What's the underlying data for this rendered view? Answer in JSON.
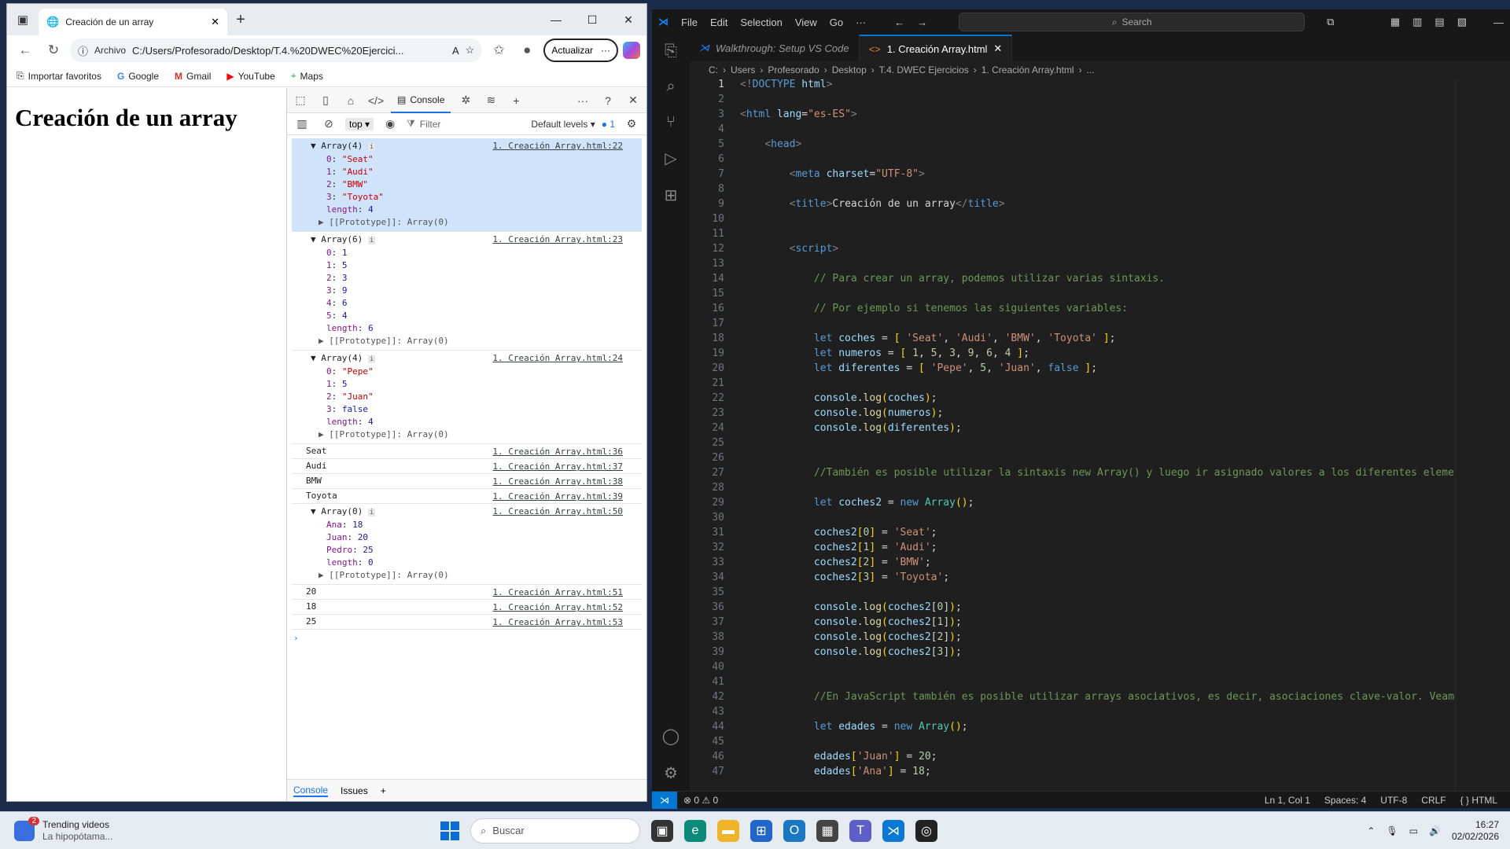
{
  "browser": {
    "tab_title": "Creación de un array",
    "address_chip": "Archivo",
    "url": "C:/Users/Profesorado/Desktop/T.4.%20DWEC%20Ejercici...",
    "update_label": "Actualizar",
    "favorites": [
      "Importar favoritos",
      "Google",
      "Gmail",
      "YouTube",
      "Maps"
    ],
    "page_heading": "Creación de un array"
  },
  "devtools": {
    "active_tab": "Console",
    "context": "top",
    "filter_placeholder": "Filter",
    "levels": "Default levels",
    "issues_count": "1",
    "drawer_tabs": [
      "Console",
      "Issues"
    ],
    "entries": [
      {
        "type": "array",
        "head": "Array(4)",
        "src": "1. Creación Array.html:22",
        "highlight": true,
        "props": [
          [
            "0",
            "\"Seat\"",
            "s"
          ],
          [
            "1",
            "\"Audi\"",
            "s"
          ],
          [
            "2",
            "\"BMW\"",
            "s"
          ],
          [
            "3",
            "\"Toyota\"",
            "s"
          ],
          [
            "length",
            "4",
            "n"
          ]
        ],
        "proto": "[[Prototype]]: Array(0)"
      },
      {
        "type": "array",
        "head": "Array(6)",
        "src": "1. Creación Array.html:23",
        "highlight": false,
        "props": [
          [
            "0",
            "1",
            "n"
          ],
          [
            "1",
            "5",
            "n"
          ],
          [
            "2",
            "3",
            "n"
          ],
          [
            "3",
            "9",
            "n"
          ],
          [
            "4",
            "6",
            "n"
          ],
          [
            "5",
            "4",
            "n"
          ],
          [
            "length",
            "6",
            "n"
          ]
        ],
        "proto": "[[Prototype]]: Array(0)"
      },
      {
        "type": "array",
        "head": "Array(4)",
        "src": "1. Creación Array.html:24",
        "highlight": false,
        "props": [
          [
            "0",
            "\"Pepe\"",
            "s"
          ],
          [
            "1",
            "5",
            "n"
          ],
          [
            "2",
            "\"Juan\"",
            "s"
          ],
          [
            "3",
            "false",
            "kw"
          ],
          [
            "length",
            "4",
            "n"
          ]
        ],
        "proto": "[[Prototype]]: Array(0)"
      },
      {
        "type": "plain",
        "text": "Seat",
        "src": "1. Creación Array.html:36"
      },
      {
        "type": "plain",
        "text": "Audi",
        "src": "1. Creación Array.html:37"
      },
      {
        "type": "plain",
        "text": "BMW",
        "src": "1. Creación Array.html:38"
      },
      {
        "type": "plain",
        "text": "Toyota",
        "src": "1. Creación Array.html:39"
      },
      {
        "type": "array",
        "head": "Array(0)",
        "src": "1. Creación Array.html:50",
        "highlight": false,
        "props": [
          [
            "Ana",
            "18",
            "n"
          ],
          [
            "Juan",
            "20",
            "n"
          ],
          [
            "Pedro",
            "25",
            "n"
          ],
          [
            "length",
            "0",
            "n"
          ]
        ],
        "proto": "[[Prototype]]: Array(0)"
      },
      {
        "type": "plain",
        "text": "20",
        "src": "1. Creación Array.html:51"
      },
      {
        "type": "plain",
        "text": "18",
        "src": "1. Creación Array.html:52"
      },
      {
        "type": "plain",
        "text": "25",
        "src": "1. Creación Array.html:53"
      }
    ]
  },
  "vscode": {
    "menu": [
      "File",
      "Edit",
      "Selection",
      "View",
      "Go",
      "···"
    ],
    "search_label": "Search",
    "tabs": [
      {
        "label": "Walkthrough: Setup VS Code",
        "active": false
      },
      {
        "label": "1. Creación Array.html",
        "active": true
      }
    ],
    "breadcrumbs": [
      "C:",
      "Users",
      "Profesorado",
      "Desktop",
      "T.4. DWEC Ejercicios",
      "1. Creación Array.html",
      "..."
    ],
    "status": {
      "errors": "0",
      "warnings": "0",
      "position": "Ln 1, Col 1",
      "spaces": "Spaces: 4",
      "encoding": "UTF-8",
      "eol": "CRLF",
      "language": "HTML"
    },
    "code_lines": [
      [
        [
          "c-tag",
          "<!"
        ],
        [
          "c-tn",
          "DOCTYPE"
        ],
        [
          "code",
          " "
        ],
        [
          "c-at",
          "html"
        ],
        [
          "c-tag",
          ">"
        ]
      ],
      [],
      [
        [
          "c-tag",
          "<"
        ],
        [
          "c-tn",
          "html"
        ],
        [
          "code",
          " "
        ],
        [
          "c-at",
          "lang"
        ],
        [
          "code",
          "="
        ],
        [
          "c-str",
          "\"es-ES\""
        ],
        [
          "c-tag",
          ">"
        ]
      ],
      [],
      [
        [
          "code",
          "    "
        ],
        [
          "c-tag",
          "<"
        ],
        [
          "c-tn",
          "head"
        ],
        [
          "c-tag",
          ">"
        ]
      ],
      [],
      [
        [
          "code",
          "        "
        ],
        [
          "c-tag",
          "<"
        ],
        [
          "c-tn",
          "meta"
        ],
        [
          "code",
          " "
        ],
        [
          "c-at",
          "charset"
        ],
        [
          "code",
          "="
        ],
        [
          "c-str",
          "\"UTF-8\""
        ],
        [
          "c-tag",
          ">"
        ]
      ],
      [],
      [
        [
          "code",
          "        "
        ],
        [
          "c-tag",
          "<"
        ],
        [
          "c-tn",
          "title"
        ],
        [
          "c-tag",
          ">"
        ],
        [
          "code",
          "Creación de un array"
        ],
        [
          "c-tag",
          "</"
        ],
        [
          "c-tn",
          "title"
        ],
        [
          "c-tag",
          ">"
        ]
      ],
      [],
      [],
      [
        [
          "code",
          "        "
        ],
        [
          "c-tag",
          "<"
        ],
        [
          "c-tn",
          "script"
        ],
        [
          "c-tag",
          ">"
        ]
      ],
      [],
      [
        [
          "code",
          "            "
        ],
        [
          "c-com",
          "// Para crear un array, podemos utilizar varias sintaxis."
        ]
      ],
      [],
      [
        [
          "code",
          "            "
        ],
        [
          "c-com",
          "// Por ejemplo si tenemos las siguientes variables:"
        ]
      ],
      [],
      [
        [
          "code",
          "            "
        ],
        [
          "c-kw",
          "let"
        ],
        [
          "code",
          " "
        ],
        [
          "c-var",
          "coches"
        ],
        [
          "code",
          " = "
        ],
        [
          "c-br",
          "["
        ],
        [
          "code",
          " "
        ],
        [
          "c-str",
          "'Seat'"
        ],
        [
          "code",
          ", "
        ],
        [
          "c-str",
          "'Audi'"
        ],
        [
          "code",
          ", "
        ],
        [
          "c-str",
          "'BMW'"
        ],
        [
          "code",
          ", "
        ],
        [
          "c-str",
          "'Toyota'"
        ],
        [
          "code",
          " "
        ],
        [
          "c-br",
          "]"
        ],
        [
          "code",
          ";"
        ]
      ],
      [
        [
          "code",
          "            "
        ],
        [
          "c-kw",
          "let"
        ],
        [
          "code",
          " "
        ],
        [
          "c-var",
          "numeros"
        ],
        [
          "code",
          " = "
        ],
        [
          "c-br",
          "["
        ],
        [
          "code",
          " "
        ],
        [
          "c-num",
          "1"
        ],
        [
          "code",
          ", "
        ],
        [
          "c-num",
          "5"
        ],
        [
          "code",
          ", "
        ],
        [
          "c-num",
          "3"
        ],
        [
          "code",
          ", "
        ],
        [
          "c-num",
          "9"
        ],
        [
          "code",
          ", "
        ],
        [
          "c-num",
          "6"
        ],
        [
          "code",
          ", "
        ],
        [
          "c-num",
          "4"
        ],
        [
          "code",
          " "
        ],
        [
          "c-br",
          "]"
        ],
        [
          "code",
          ";"
        ]
      ],
      [
        [
          "code",
          "            "
        ],
        [
          "c-kw",
          "let"
        ],
        [
          "code",
          " "
        ],
        [
          "c-var",
          "diferentes"
        ],
        [
          "code",
          " = "
        ],
        [
          "c-br",
          "["
        ],
        [
          "code",
          " "
        ],
        [
          "c-str",
          "'Pepe'"
        ],
        [
          "code",
          ", "
        ],
        [
          "c-num",
          "5"
        ],
        [
          "code",
          ", "
        ],
        [
          "c-str",
          "'Juan'"
        ],
        [
          "code",
          ", "
        ],
        [
          "c-kw",
          "false"
        ],
        [
          "code",
          " "
        ],
        [
          "c-br",
          "]"
        ],
        [
          "code",
          ";"
        ]
      ],
      [],
      [
        [
          "code",
          "            "
        ],
        [
          "c-var",
          "console"
        ],
        [
          "code",
          "."
        ],
        [
          "c-fn",
          "log"
        ],
        [
          "c-br",
          "("
        ],
        [
          "c-var",
          "coches"
        ],
        [
          "c-br",
          ")"
        ],
        [
          "code",
          ";"
        ]
      ],
      [
        [
          "code",
          "            "
        ],
        [
          "c-var",
          "console"
        ],
        [
          "code",
          "."
        ],
        [
          "c-fn",
          "log"
        ],
        [
          "c-br",
          "("
        ],
        [
          "c-var",
          "numeros"
        ],
        [
          "c-br",
          ")"
        ],
        [
          "code",
          ";"
        ]
      ],
      [
        [
          "code",
          "            "
        ],
        [
          "c-var",
          "console"
        ],
        [
          "code",
          "."
        ],
        [
          "c-fn",
          "log"
        ],
        [
          "c-br",
          "("
        ],
        [
          "c-var",
          "diferentes"
        ],
        [
          "c-br",
          ")"
        ],
        [
          "code",
          ";"
        ]
      ],
      [],
      [],
      [
        [
          "code",
          "            "
        ],
        [
          "c-com",
          "//También es posible utilizar la sintaxis new Array() y luego ir asignado valores a los diferentes element"
        ]
      ],
      [],
      [
        [
          "code",
          "            "
        ],
        [
          "c-kw",
          "let"
        ],
        [
          "code",
          " "
        ],
        [
          "c-var",
          "coches2"
        ],
        [
          "code",
          " = "
        ],
        [
          "c-kw",
          "new"
        ],
        [
          "code",
          " "
        ],
        [
          "c-cls",
          "Array"
        ],
        [
          "c-br",
          "()"
        ],
        [
          "code",
          ";"
        ]
      ],
      [],
      [
        [
          "code",
          "            "
        ],
        [
          "c-var",
          "coches2"
        ],
        [
          "c-br",
          "["
        ],
        [
          "c-num",
          "0"
        ],
        [
          "c-br",
          "]"
        ],
        [
          "code",
          " = "
        ],
        [
          "c-str",
          "'Seat'"
        ],
        [
          "code",
          ";"
        ]
      ],
      [
        [
          "code",
          "            "
        ],
        [
          "c-var",
          "coches2"
        ],
        [
          "c-br",
          "["
        ],
        [
          "c-num",
          "1"
        ],
        [
          "c-br",
          "]"
        ],
        [
          "code",
          " = "
        ],
        [
          "c-str",
          "'Audi'"
        ],
        [
          "code",
          ";"
        ]
      ],
      [
        [
          "code",
          "            "
        ],
        [
          "c-var",
          "coches2"
        ],
        [
          "c-br",
          "["
        ],
        [
          "c-num",
          "2"
        ],
        [
          "c-br",
          "]"
        ],
        [
          "code",
          " = "
        ],
        [
          "c-str",
          "'BMW'"
        ],
        [
          "code",
          ";"
        ]
      ],
      [
        [
          "code",
          "            "
        ],
        [
          "c-var",
          "coches2"
        ],
        [
          "c-br",
          "["
        ],
        [
          "c-num",
          "3"
        ],
        [
          "c-br",
          "]"
        ],
        [
          "code",
          " = "
        ],
        [
          "c-str",
          "'Toyota'"
        ],
        [
          "code",
          ";"
        ]
      ],
      [],
      [
        [
          "code",
          "            "
        ],
        [
          "c-var",
          "console"
        ],
        [
          "code",
          "."
        ],
        [
          "c-fn",
          "log"
        ],
        [
          "c-br",
          "("
        ],
        [
          "c-var",
          "coches2"
        ],
        [
          "code",
          "["
        ],
        [
          "c-num",
          "0"
        ],
        [
          "code",
          "]"
        ],
        [
          "c-br",
          ")"
        ],
        [
          "code",
          ";"
        ]
      ],
      [
        [
          "code",
          "            "
        ],
        [
          "c-var",
          "console"
        ],
        [
          "code",
          "."
        ],
        [
          "c-fn",
          "log"
        ],
        [
          "c-br",
          "("
        ],
        [
          "c-var",
          "coches2"
        ],
        [
          "code",
          "["
        ],
        [
          "c-num",
          "1"
        ],
        [
          "code",
          "]"
        ],
        [
          "c-br",
          ")"
        ],
        [
          "code",
          ";"
        ]
      ],
      [
        [
          "code",
          "            "
        ],
        [
          "c-var",
          "console"
        ],
        [
          "code",
          "."
        ],
        [
          "c-fn",
          "log"
        ],
        [
          "c-br",
          "("
        ],
        [
          "c-var",
          "coches2"
        ],
        [
          "code",
          "["
        ],
        [
          "c-num",
          "2"
        ],
        [
          "code",
          "]"
        ],
        [
          "c-br",
          ")"
        ],
        [
          "code",
          ";"
        ]
      ],
      [
        [
          "code",
          "            "
        ],
        [
          "c-var",
          "console"
        ],
        [
          "code",
          "."
        ],
        [
          "c-fn",
          "log"
        ],
        [
          "c-br",
          "("
        ],
        [
          "c-var",
          "coches2"
        ],
        [
          "code",
          "["
        ],
        [
          "c-num",
          "3"
        ],
        [
          "code",
          "]"
        ],
        [
          "c-br",
          ")"
        ],
        [
          "code",
          ";"
        ]
      ],
      [],
      [],
      [
        [
          "code",
          "            "
        ],
        [
          "c-com",
          "//En JavaScript también es posible utilizar arrays asociativos, es decir, asociaciones clave-valor. Veamos"
        ]
      ],
      [],
      [
        [
          "code",
          "            "
        ],
        [
          "c-kw",
          "let"
        ],
        [
          "code",
          " "
        ],
        [
          "c-var",
          "edades"
        ],
        [
          "code",
          " = "
        ],
        [
          "c-kw",
          "new"
        ],
        [
          "code",
          " "
        ],
        [
          "c-cls",
          "Array"
        ],
        [
          "c-br",
          "()"
        ],
        [
          "code",
          ";"
        ]
      ],
      [],
      [
        [
          "code",
          "            "
        ],
        [
          "c-var",
          "edades"
        ],
        [
          "c-br",
          "["
        ],
        [
          "c-str",
          "'Juan'"
        ],
        [
          "c-br",
          "]"
        ],
        [
          "code",
          " = "
        ],
        [
          "c-num",
          "20"
        ],
        [
          "code",
          ";"
        ]
      ],
      [
        [
          "code",
          "            "
        ],
        [
          "c-var",
          "edades"
        ],
        [
          "c-br",
          "["
        ],
        [
          "c-str",
          "'Ana'"
        ],
        [
          "c-br",
          "]"
        ],
        [
          "code",
          " = "
        ],
        [
          "c-num",
          "18"
        ],
        [
          "code",
          ";"
        ]
      ]
    ]
  },
  "taskbar": {
    "widget_title": "Trending videos",
    "widget_sub": "La hipopótama...",
    "widget_badge": "2",
    "search_placeholder": "Buscar",
    "time": "16:27",
    "date": "02/02/2026"
  }
}
